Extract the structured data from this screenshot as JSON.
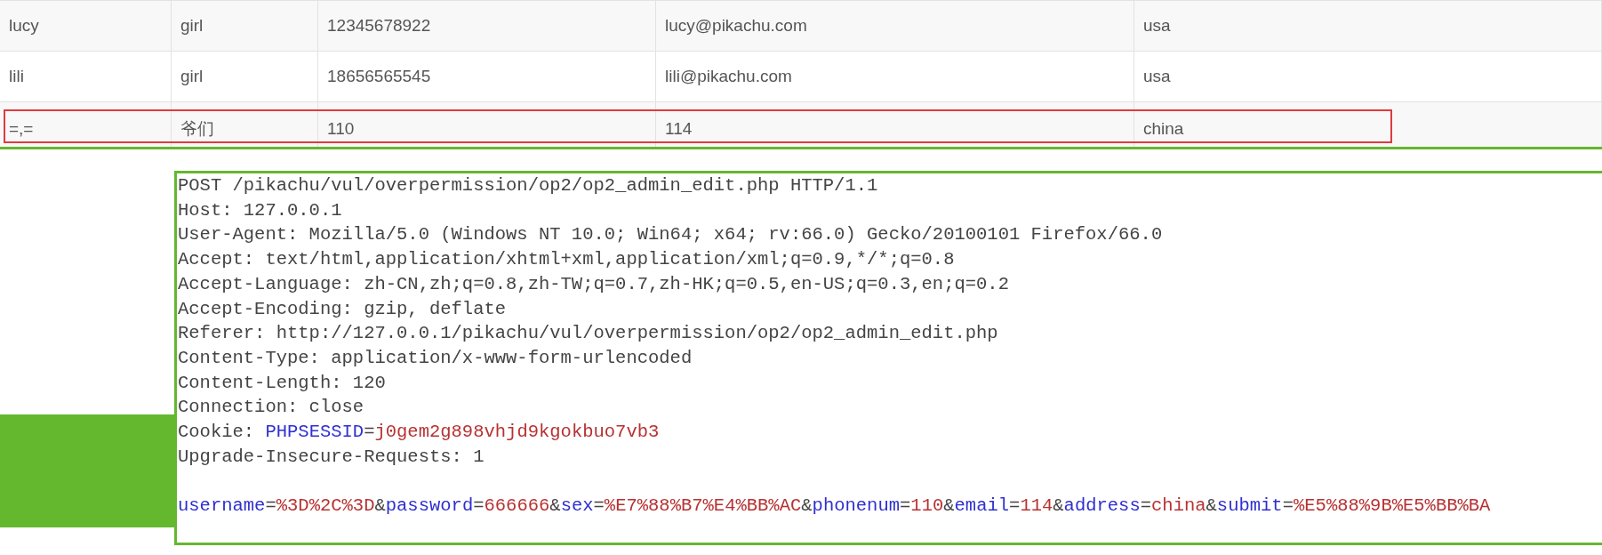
{
  "table": {
    "rows": [
      {
        "cells": [
          "lucy",
          "girl",
          "12345678922",
          "lucy@pikachu.com",
          "usa"
        ],
        "highlighted": false
      },
      {
        "cells": [
          "lili",
          "girl",
          "18656565545",
          "lili@pikachu.com",
          "usa"
        ],
        "highlighted": false
      },
      {
        "cells": [
          "=,=",
          "爷们",
          "110",
          "114",
          "china"
        ],
        "highlighted": true
      }
    ]
  },
  "request": {
    "headers": [
      [
        {
          "kind": "plain",
          "text": "POST /pikachu/vul/overpermission/op2/op2_admin_edit.php HTTP/1.1"
        }
      ],
      [
        {
          "kind": "plain",
          "text": "Host: 127.0.0.1"
        }
      ],
      [
        {
          "kind": "plain",
          "text": "User-Agent: Mozilla/5.0 (Windows NT 10.0; Win64; x64; rv:66.0) Gecko/20100101 Firefox/66.0"
        }
      ],
      [
        {
          "kind": "plain",
          "text": "Accept: text/html,application/xhtml+xml,application/xml;q=0.9,*/*;q=0.8"
        }
      ],
      [
        {
          "kind": "plain",
          "text": "Accept-Language: zh-CN,zh;q=0.8,zh-TW;q=0.7,zh-HK;q=0.5,en-US;q=0.3,en;q=0.2"
        }
      ],
      [
        {
          "kind": "plain",
          "text": "Accept-Encoding: gzip, deflate"
        }
      ],
      [
        {
          "kind": "plain",
          "text": "Referer: http://127.0.0.1/pikachu/vul/overpermission/op2/op2_admin_edit.php"
        }
      ],
      [
        {
          "kind": "plain",
          "text": "Content-Type: application/x-www-form-urlencoded"
        }
      ],
      [
        {
          "kind": "plain",
          "text": "Content-Length: 120"
        }
      ],
      [
        {
          "kind": "plain",
          "text": "Connection: close"
        }
      ],
      [
        {
          "kind": "plain",
          "text": "Cookie: "
        },
        {
          "kind": "key",
          "text": "PHPSESSID"
        },
        {
          "kind": "plain",
          "text": "="
        },
        {
          "kind": "value",
          "text": "j0gem2g898vhjd9kgokbuo7vb3"
        }
      ],
      [
        {
          "kind": "plain",
          "text": "Upgrade-Insecure-Requests: 1"
        }
      ]
    ],
    "body": [
      {
        "kind": "key",
        "text": "username"
      },
      {
        "kind": "plain",
        "text": "="
      },
      {
        "kind": "value",
        "text": "%3D%2C%3D"
      },
      {
        "kind": "plain",
        "text": "&"
      },
      {
        "kind": "key",
        "text": "password"
      },
      {
        "kind": "plain",
        "text": "="
      },
      {
        "kind": "value",
        "text": "666666"
      },
      {
        "kind": "plain",
        "text": "&"
      },
      {
        "kind": "key",
        "text": "sex"
      },
      {
        "kind": "plain",
        "text": "="
      },
      {
        "kind": "value",
        "text": "%E7%88%B7%E4%BB%AC"
      },
      {
        "kind": "plain",
        "text": "&"
      },
      {
        "kind": "key",
        "text": "phonenum"
      },
      {
        "kind": "plain",
        "text": "="
      },
      {
        "kind": "value",
        "text": "110"
      },
      {
        "kind": "plain",
        "text": "&"
      },
      {
        "kind": "key",
        "text": "email"
      },
      {
        "kind": "plain",
        "text": "="
      },
      {
        "kind": "value",
        "text": "114"
      },
      {
        "kind": "plain",
        "text": "&"
      },
      {
        "kind": "key",
        "text": "address"
      },
      {
        "kind": "plain",
        "text": "="
      },
      {
        "kind": "value",
        "text": "china"
      },
      {
        "kind": "plain",
        "text": "&"
      },
      {
        "kind": "key",
        "text": "submit"
      },
      {
        "kind": "plain",
        "text": "="
      },
      {
        "kind": "value",
        "text": "%E5%88%9B%E5%BB%BA"
      }
    ]
  }
}
